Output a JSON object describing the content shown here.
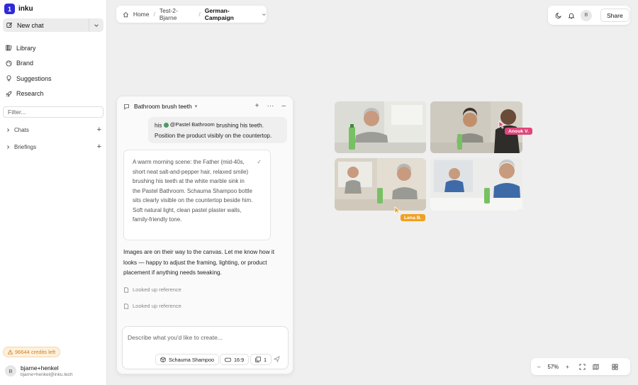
{
  "app": {
    "name": "inku",
    "logo_letter": "1"
  },
  "sidebar": {
    "new_chat": "New chat",
    "items": [
      {
        "label": "Library",
        "icon": "library-icon"
      },
      {
        "label": "Brand",
        "icon": "palette-icon"
      },
      {
        "label": "Suggestions",
        "icon": "lightbulb-icon"
      },
      {
        "label": "Research",
        "icon": "rocket-icon"
      }
    ],
    "filter_placeholder": "Filter...",
    "sections": [
      {
        "label": "Chats"
      },
      {
        "label": "Briefings"
      }
    ],
    "credits": "96644 credits left",
    "user": {
      "initial": "B",
      "name": "bjarne+henkel",
      "email": "bjarne+henkel@inku.tech"
    }
  },
  "breadcrumb": {
    "home": "Home",
    "project": "Test-2-Bjarne",
    "current": "German-Campaign"
  },
  "topbar": {
    "avatar_initial": "B",
    "share_label": "Share"
  },
  "chat": {
    "title": "Bathroom brush teeth",
    "user_message": {
      "prefix": "his",
      "mention": "@Pastel Bathroom",
      "suffix": "brushing his teeth.",
      "line2": "Position the product visibly on the countertop."
    },
    "prompt_card": "A warm morning scene: the Father (mid-40s, short neat salt-and-pepper hair, relaxed smile) brushing his teeth at the white marble sink in the Pastel Bathroom. Schauma Shampoo bottle sits clearly visible on the countertop beside him. Soft natural light, clean pastel plaster walls, family-friendly tone.",
    "assistant_message": "Images are on their way to the canvas. Let me know how it looks — happy to adjust the framing, lighting, or product placement if anything needs tweaking.",
    "lookups": [
      "Looked up reference",
      "Looked up reference"
    ],
    "input_placeholder": "Describe what you'd like to create...",
    "pills": {
      "product": "Schauma Shampoo",
      "ratio": "16:9",
      "count": "1"
    }
  },
  "canvas": {
    "collaborators": [
      {
        "name": "Anouk V.",
        "color": "#e0457b"
      },
      {
        "name": "Lena B.",
        "color": "#f0a020"
      }
    ]
  },
  "zoom": {
    "level": "57%"
  },
  "colors": {
    "accent": "#2f2bd6",
    "credits": "#d3801c"
  }
}
